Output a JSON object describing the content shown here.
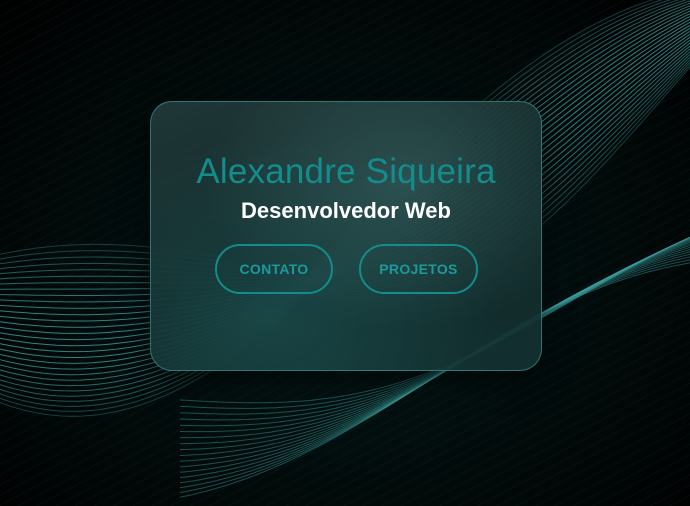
{
  "profile": {
    "name": "Alexandre Siqueira",
    "role": "Desenvolvedor Web"
  },
  "actions": {
    "contact_label": "CONTATO",
    "projects_label": "PROJETOS"
  },
  "colors": {
    "accent": "#138c8c",
    "background": "#000000",
    "role_text": "#ffffff"
  }
}
